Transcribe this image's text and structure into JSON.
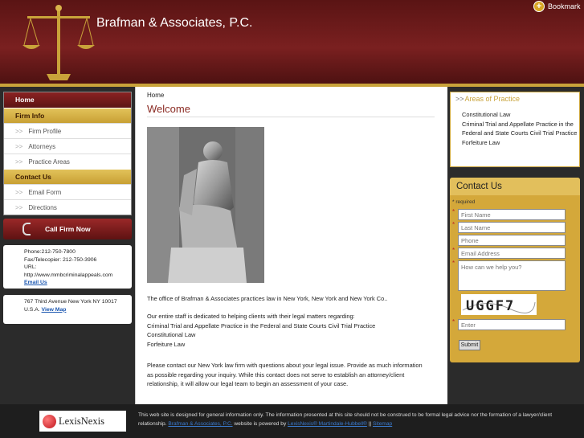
{
  "header": {
    "title": "Brafman & Associates, P.C.",
    "bookmark_label": "Bookmark"
  },
  "nav": {
    "home": "Home",
    "firm_info": "Firm Info",
    "firm_items": [
      "Firm Profile",
      "Attorneys",
      "Practice Areas"
    ],
    "contact_us": "Contact Us",
    "contact_items": [
      "Email Form",
      "Directions"
    ],
    "arrow": ">>"
  },
  "call": {
    "label": "Call Firm Now"
  },
  "contact_info": {
    "phone": "Phone:212-750-7800",
    "fax": "Fax/Telecopier: 212-750-3906",
    "url_label": "URL:",
    "url": "http://www.mmbcriminalappeals.com",
    "email_link": "Email Us"
  },
  "address": {
    "line1": "767 Third Avenue New York NY 10017",
    "line2": "U.S.A.",
    "map_link": "View Map"
  },
  "main": {
    "breadcrumb": "Home",
    "title": "Welcome",
    "p1": "The office of Brafman & Associates practices law in New York, New York and New York Co..",
    "p2_lines": [
      "Our entire staff is dedicated to helping clients with their legal matters regarding:",
      "Criminal Trial and Appellate Practice in the Federal and State Courts Civil Trial Practice",
      "Constitutional Law",
      "Forfeiture Law"
    ],
    "p3": "Please contact our New York law firm with questions about your legal issue. Provide as much information as possible regarding your inquiry. While this contact does not serve to establish an attorney/client relationship, it will allow our legal team to begin an assessment of your case."
  },
  "areas": {
    "title": "Areas of Practice",
    "arrow": ">>",
    "items": [
      "Constitutional Law",
      "Criminal Trial and Appellate Practice in the Federal and State Courts Civil Trial Practice",
      "Forfeiture Law"
    ]
  },
  "form": {
    "title": "Contact Us",
    "required_note": "* required",
    "first_name": "First Name",
    "last_name": "Last Name",
    "phone": "Phone",
    "email": "Email Address",
    "message": "How can we help you?",
    "captcha_text": "UGGF7",
    "captcha_input": "Enter",
    "submit": "Submit"
  },
  "footer": {
    "logo": "LexisNexis",
    "text1": "This web site is designed for general information only. The information presented at this site should not be construed to be formal legal advice nor the formation of a lawyer/client relationship.",
    "link1": "Brafman & Associates, P.C.",
    "text2": "website is powered by",
    "link2": "LexisNexis® Martindale-Hubbell®",
    "sep": "||",
    "link3": "Sitemap"
  },
  "colors": {
    "header_red": "#6e1a1a",
    "gold": "#c9a33a",
    "welcome": "#8a2a22",
    "link": "#1a56b0"
  }
}
